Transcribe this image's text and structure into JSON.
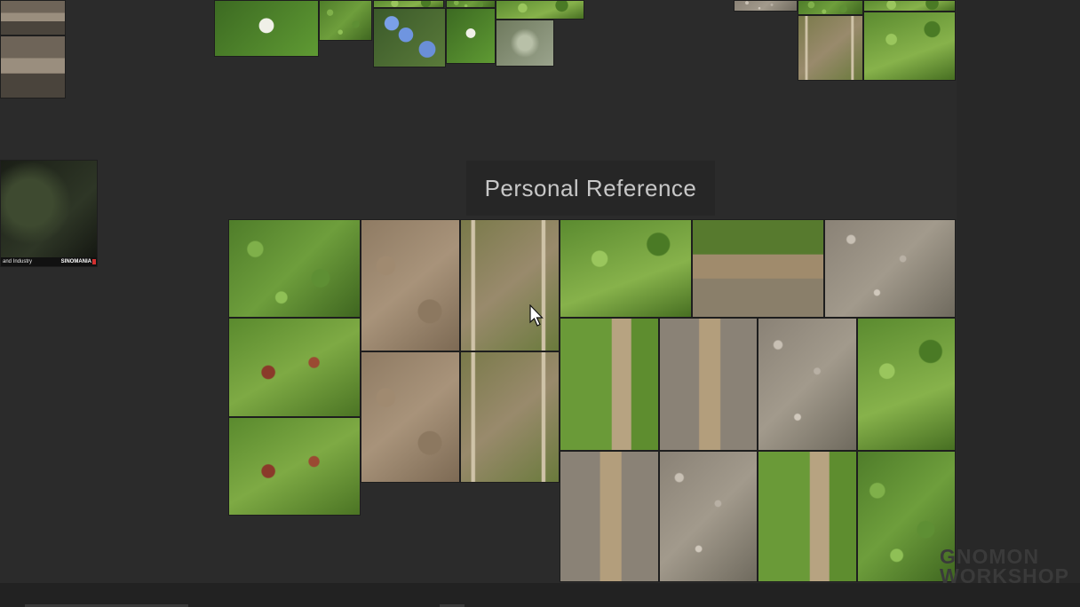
{
  "board": {
    "group_label": "Personal Reference",
    "caption_text": "and Industry",
    "caption_logo": "SINOMANIA"
  },
  "watermark": {
    "line1": "GNOMON",
    "line2": "WORKSHOP"
  },
  "colors": {
    "canvas": "#2b2b2b",
    "label_bg": "#262626",
    "label_text": "#c7c7c7"
  }
}
